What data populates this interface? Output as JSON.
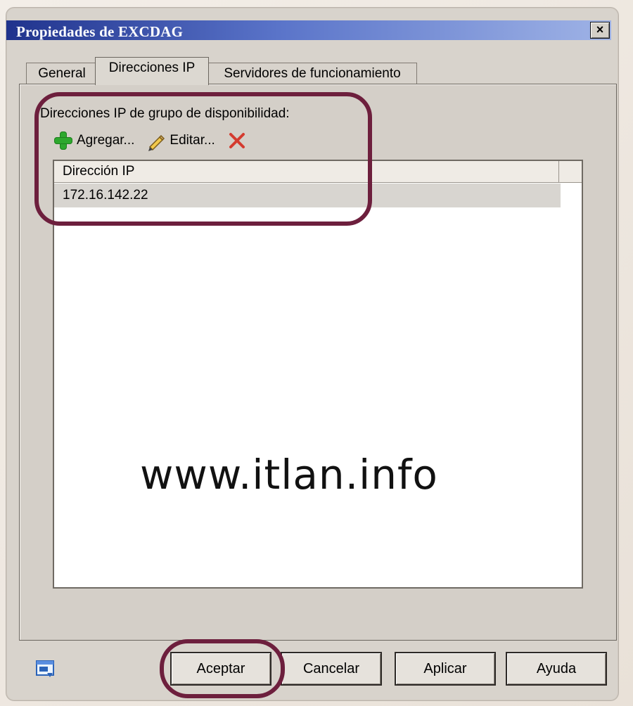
{
  "window": {
    "title": "Propiedades de EXCDAG",
    "close_label": "×"
  },
  "tabs": [
    {
      "label": "General"
    },
    {
      "label": "Direcciones IP"
    },
    {
      "label": "Servidores de funcionamiento"
    }
  ],
  "section": {
    "label": "Direcciones IP de grupo de disponibilidad:"
  },
  "toolbar": {
    "add_label": "Agregar...",
    "edit_label": "Editar..."
  },
  "list": {
    "column": "Dirección IP",
    "rows": [
      {
        "ip": "172.16.142.22"
      }
    ]
  },
  "watermark": "www.itlan.info",
  "footer": {
    "ok_label": "Aceptar",
    "cancel_label": "Cancelar",
    "apply_label": "Aplicar",
    "help_label": "Ayuda"
  },
  "colors": {
    "title_start": "#20338d",
    "title_end": "#9fb3e6",
    "highlight": "#6d1f3d",
    "plus": "#2ea82e",
    "delete": "#d43b2f"
  }
}
